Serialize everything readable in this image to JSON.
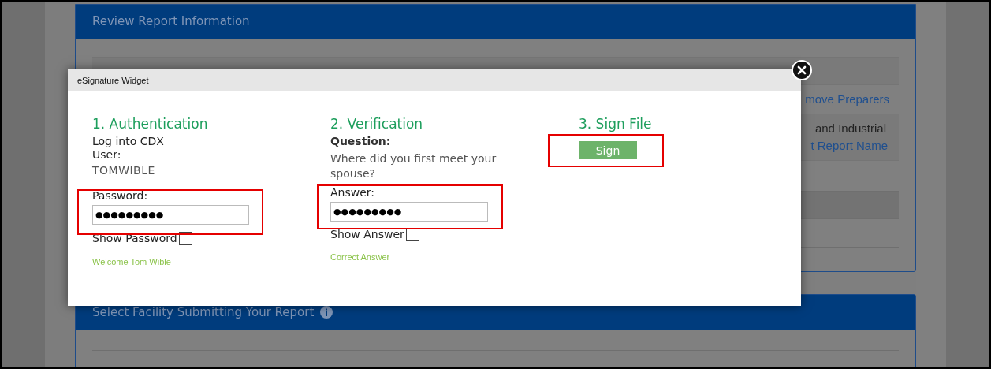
{
  "background_page": {
    "panel_1": {
      "title": "Review Report Information",
      "remove_link": "move Preparers",
      "row_text": "and Industrial",
      "edit_link": "t Report Name"
    },
    "panel_2": {
      "title": "Select Facility Submitting Your Report"
    }
  },
  "dialog": {
    "title": "eSignature Widget",
    "authentication": {
      "heading": "1. Authentication",
      "intro": "Log into CDX",
      "user_label": "User:",
      "user": "TOMWIBLE",
      "password_label": "Password:",
      "password": "●●●●●●●●●",
      "show_label": "Show Password",
      "show_checked": false,
      "status": "Welcome Tom Wible"
    },
    "verification": {
      "heading": "2. Verification",
      "question_label": "Question:",
      "question": "Where did you first meet your spouse?",
      "answer_label": "Answer:",
      "answer": "●●●●●●●●●",
      "show_label": "Show Answer",
      "show_checked": false,
      "status": "Correct Answer"
    },
    "sign": {
      "heading": "3. Sign File",
      "button": "Sign"
    }
  }
}
